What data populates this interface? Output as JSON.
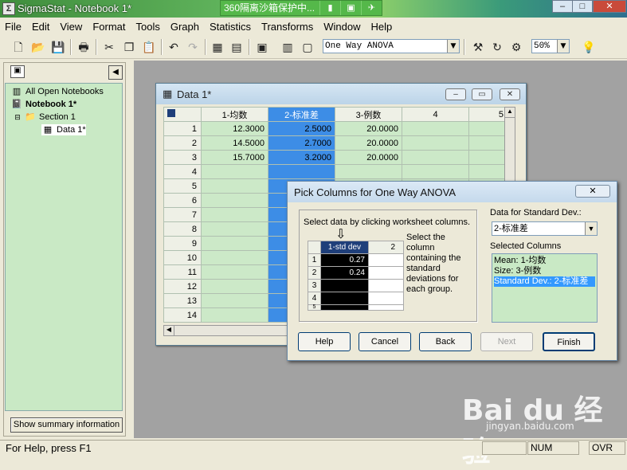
{
  "window": {
    "title": "SigmaStat - Notebook 1*",
    "app_icon": "Σ"
  },
  "banner": {
    "text": "360隔离沙箱保护中...",
    "icons": [
      "book-icon",
      "square-icon",
      "pin-icon"
    ]
  },
  "menu": [
    "File",
    "Edit",
    "View",
    "Format",
    "Tools",
    "Graph",
    "Statistics",
    "Transforms",
    "Window",
    "Help"
  ],
  "toolbar": {
    "test_select": "One Way ANOVA",
    "zoom": "50%"
  },
  "tree": {
    "all_notebooks": "All Open Notebooks",
    "notebook": "Notebook 1*",
    "section": "Section 1",
    "data": "Data 1*"
  },
  "summary_button": "Show summary information",
  "data_window": {
    "title": "Data 1*",
    "columns": [
      "1-均数",
      "2-标准差",
      "3-例数",
      "4",
      "5"
    ],
    "rows": [
      [
        "1",
        "12.3000",
        "2.5000",
        "20.0000"
      ],
      [
        "2",
        "14.5000",
        "2.7000",
        "20.0000"
      ],
      [
        "3",
        "15.7000",
        "3.2000",
        "20.0000"
      ],
      [
        "4",
        "",
        "",
        ""
      ],
      [
        "5",
        "",
        "",
        ""
      ],
      [
        "6",
        "",
        "",
        ""
      ],
      [
        "7",
        "",
        "",
        ""
      ],
      [
        "8",
        "",
        "",
        ""
      ],
      [
        "9",
        "",
        "",
        ""
      ],
      [
        "10",
        "",
        "",
        ""
      ],
      [
        "11",
        "",
        "",
        ""
      ],
      [
        "12",
        "",
        "",
        ""
      ],
      [
        "13",
        "",
        "",
        ""
      ],
      [
        "14",
        "",
        "",
        ""
      ]
    ]
  },
  "dialog": {
    "title": "Pick Columns for One Way ANOVA",
    "instruction": "Select data by clicking worksheet columns.",
    "mini_columns": [
      "1-std dev",
      "2"
    ],
    "mini_rows": [
      [
        "1",
        "0.27"
      ],
      [
        "2",
        "0.24"
      ],
      [
        "3",
        ""
      ],
      [
        "4",
        ""
      ],
      [
        "5",
        ""
      ]
    ],
    "hint_lines": [
      "Select the",
      "column",
      "containing the",
      "standard",
      "deviations for",
      "each group."
    ],
    "data_for_label": "Data for Standard Dev.:",
    "data_for_value": "2-标准差",
    "selected_label": "Selected Columns",
    "selected": [
      "Mean: 1-均数",
      "Size: 3-例数",
      "Standard Dev.: 2-标准差"
    ],
    "buttons": {
      "help": "Help",
      "cancel": "Cancel",
      "back": "Back",
      "next": "Next",
      "finish": "Finish"
    }
  },
  "status": {
    "help_text": "For Help, press F1",
    "num": "NUM",
    "ovr": "OVR"
  },
  "watermark": {
    "brand": "Bai du 经验",
    "url": "jingyan.baidu.com"
  }
}
